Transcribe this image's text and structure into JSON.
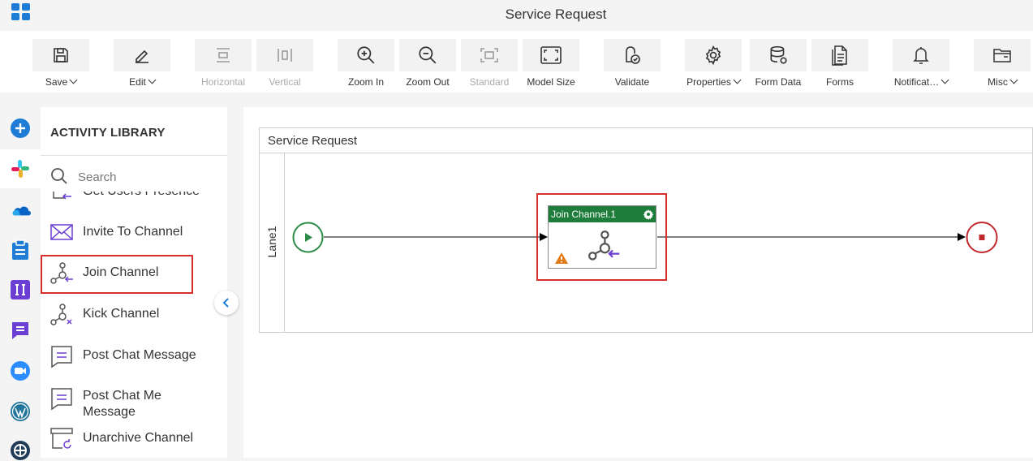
{
  "app": {
    "title": "Service Request"
  },
  "toolbar": {
    "save": "Save",
    "edit": "Edit",
    "horizontal": "Horizontal",
    "vertical": "Vertical",
    "zoom_in": "Zoom In",
    "zoom_out": "Zoom Out",
    "standard": "Standard",
    "model_size": "Model Size",
    "validate": "Validate",
    "properties": "Properties",
    "form_data": "Form Data",
    "forms": "Forms",
    "notifications": "Notificat…",
    "misc": "Misc"
  },
  "rail": {
    "icons": [
      "add-icon",
      "slack-icon",
      "onedrive-icon",
      "clipboard-icon",
      "text-cursor-icon",
      "chat-icon",
      "zoom-video-icon",
      "wordpress-icon",
      "wheel-icon"
    ]
  },
  "library": {
    "title": "ACTIVITY LIBRARY",
    "search_placeholder": "Search",
    "items": [
      {
        "label": "Get Users Presence"
      },
      {
        "label": "Invite To Channel"
      },
      {
        "label": "Join Channel"
      },
      {
        "label": "Kick Channel"
      },
      {
        "label": "Post Chat Message"
      },
      {
        "label": "Post Chat Me Message"
      },
      {
        "label": "Unarchive Channel"
      }
    ]
  },
  "canvas": {
    "pool_title": "Service Request",
    "lane_label": "Lane1",
    "task_title": "Join Channel.1"
  },
  "colors": {
    "accent": "#1e7bd6",
    "task_header": "#1e7d3a",
    "start": "#2e8b47",
    "end": "#c0282e",
    "highlight": "#d32f2f",
    "purple": "#6b3fd4"
  }
}
